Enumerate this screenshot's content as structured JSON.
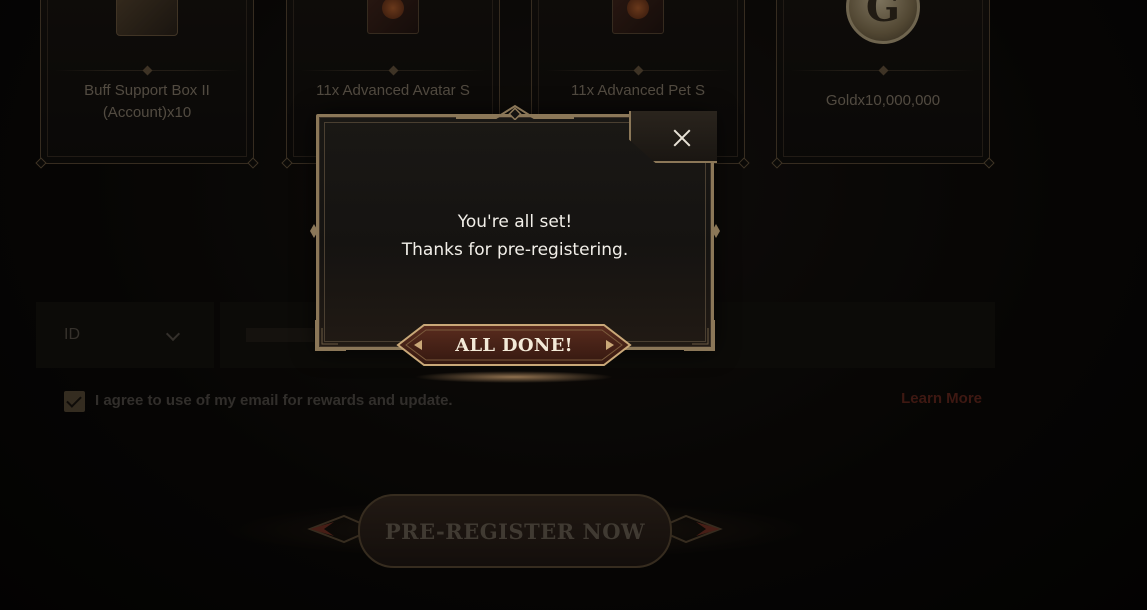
{
  "rewards": [
    {
      "label": "Buff Support Box II (Account)x10",
      "icon": "gift-box-icon"
    },
    {
      "label": "11x Advanced Avatar S",
      "icon": "card-pack-icon"
    },
    {
      "label": "11x Advanced Pet S",
      "icon": "card-pack-icon"
    },
    {
      "label": "Goldx10,000,000",
      "icon": "gold-coin-icon",
      "coin_letter": "G"
    }
  ],
  "form": {
    "id_select_value": "ID",
    "agree_text": "I agree to use of my email for rewards and update.",
    "agree_checked": true,
    "learn_more": "Learn More",
    "preregister_label": "PRE-REGISTER NOW"
  },
  "modal": {
    "message_line1": "You're all set!",
    "message_line2": "Thanks for pre-registering.",
    "done_label": "ALL DONE!",
    "close_icon": "close-icon"
  },
  "colors": {
    "accent_gold": "#8b7758",
    "learn_more_red": "#6b2a1f",
    "done_button": "#4a2418"
  }
}
